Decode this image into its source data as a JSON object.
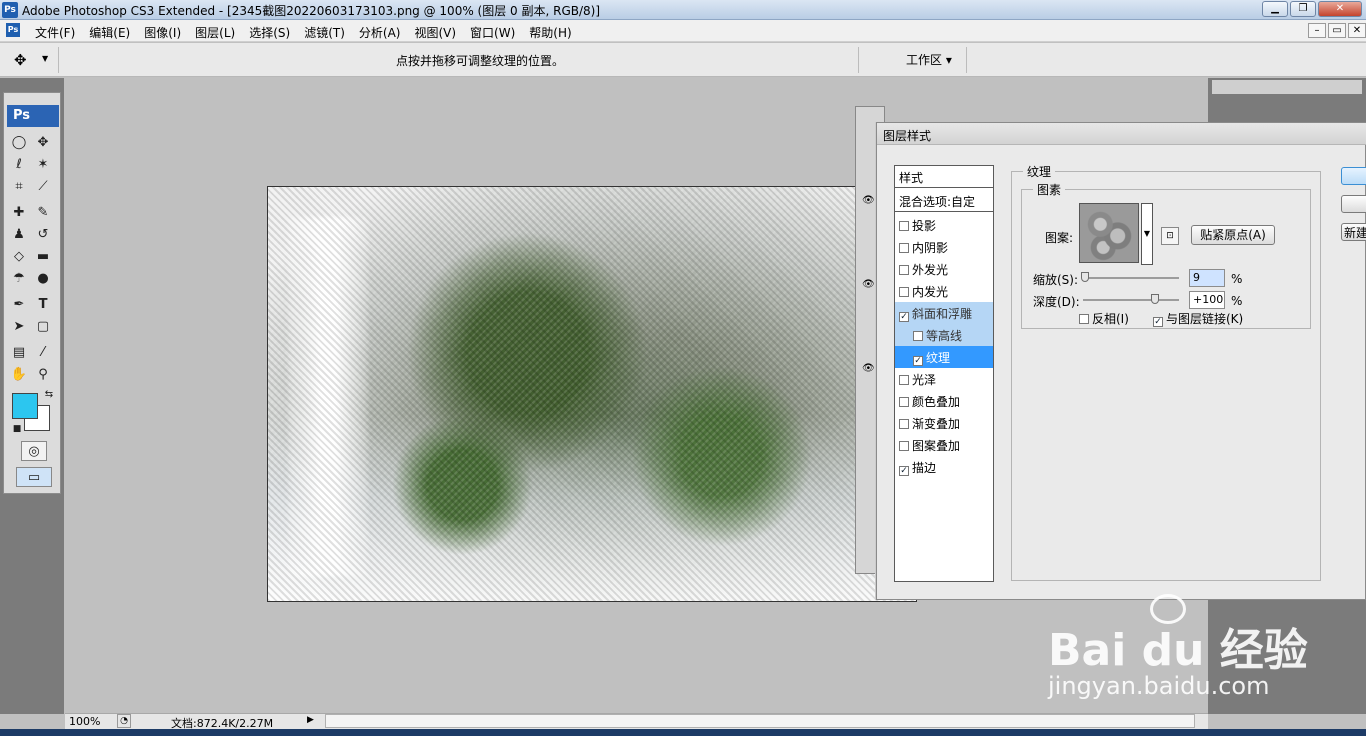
{
  "window": {
    "title": "Adobe Photoshop CS3 Extended - [2345截图20220603173103.png @ 100% (图层 0 副本, RGB/8)]",
    "app_icon": "Ps"
  },
  "menubar": {
    "items": [
      "文件(F)",
      "编辑(E)",
      "图像(I)",
      "图层(L)",
      "选择(S)",
      "滤镜(T)",
      "分析(A)",
      "视图(V)",
      "窗口(W)",
      "帮助(H)"
    ]
  },
  "options": {
    "hint": "点按并拖移可调整纹理的位置。",
    "workspace": "工作区 ▾"
  },
  "toolbox": {
    "logo": "Ps",
    "colors": {
      "foreground": "#2cc6ef",
      "background": "#ffffff"
    }
  },
  "status": {
    "zoom": "100%",
    "doc": "文档:872.4K/2.27M"
  },
  "dialog": {
    "title": "图层样式",
    "styles_header": "样式",
    "blend_options": "混合选项:自定",
    "styles": [
      {
        "label": "投影",
        "checked": false
      },
      {
        "label": "内阴影",
        "checked": false
      },
      {
        "label": "外发光",
        "checked": false
      },
      {
        "label": "内发光",
        "checked": false
      },
      {
        "label": "斜面和浮雕",
        "checked": true
      },
      {
        "label": "等高线",
        "checked": false
      },
      {
        "label": "纹理",
        "checked": true
      },
      {
        "label": "光泽",
        "checked": false
      },
      {
        "label": "颜色叠加",
        "checked": false
      },
      {
        "label": "渐变叠加",
        "checked": false
      },
      {
        "label": "图案叠加",
        "checked": false
      },
      {
        "label": "描边",
        "checked": true
      }
    ],
    "texture": {
      "group_label": "纹理",
      "pattern_group_label": "图素",
      "pattern_label": "图案:",
      "snap_button": "贴紧原点(A)",
      "scale_label": "缩放(S):",
      "scale_value": "9",
      "scale_fraction": 0.02,
      "depth_label": "深度(D):",
      "depth_value": "+100",
      "depth_fraction": 0.75,
      "percent": "%",
      "invert_label": "反相(I)",
      "invert_checked": false,
      "link_label": "与图层链接(K)",
      "link_checked": true
    },
    "right_buttons": [
      "",
      "",
      "新建"
    ]
  },
  "watermark": {
    "brand": "Bai du 经验",
    "url": "jingyan.baidu.com"
  }
}
